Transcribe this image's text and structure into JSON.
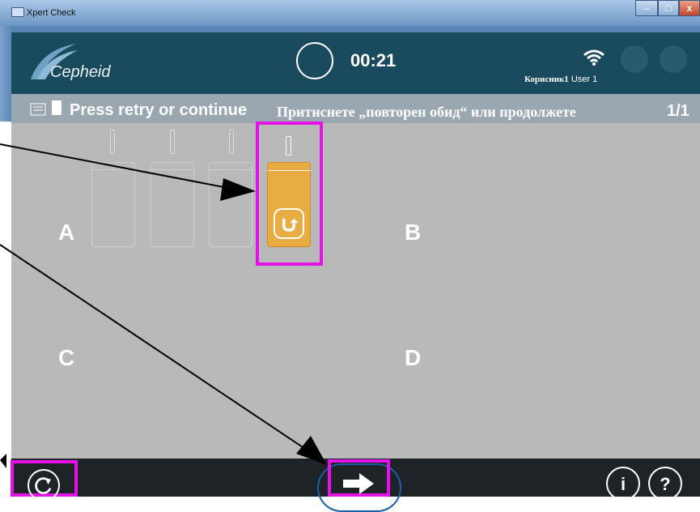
{
  "window": {
    "title": "Xpert Check"
  },
  "header": {
    "logo_text": "Cepheid",
    "timer": "00:21",
    "user_label": "Корисник1",
    "user_name": "User 1"
  },
  "instruction": {
    "text": "Press retry or continue",
    "translation": "Притиснете „повторен обид“ или продолжете",
    "page_count": "1/1"
  },
  "slots": {
    "a": "A",
    "b": "B",
    "c": "C",
    "d": "D"
  },
  "footer": {
    "info_label": "i",
    "help_label": "?"
  },
  "colors": {
    "header_bg": "#1a4a5e",
    "instruction_bg": "#9aa7b0",
    "main_bg": "#b9b9b9",
    "module_active": "#e9ac43",
    "highlight": "#e412e6",
    "footer_bg": "#1d2326",
    "next_ring": "#1b5fa8"
  },
  "icons": [
    "app-icon",
    "wifi-icon",
    "home-icon",
    "lock-icon",
    "document-icon",
    "retry-icon",
    "arrow-right-icon",
    "info-icon",
    "help-icon"
  ]
}
